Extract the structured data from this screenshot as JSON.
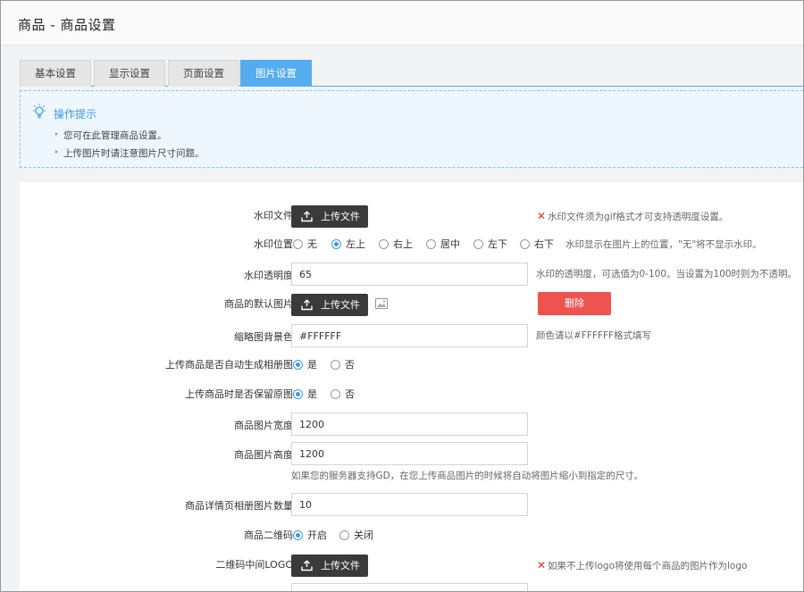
{
  "header": {
    "title": "商品 - 商品设置"
  },
  "tabs": [
    {
      "label": "基本设置",
      "active": false
    },
    {
      "label": "显示设置",
      "active": false
    },
    {
      "label": "页面设置",
      "active": false
    },
    {
      "label": "图片设置",
      "active": true
    }
  ],
  "tips": {
    "title": "操作提示",
    "items": [
      "您可在此管理商品设置。",
      "上传图片时请注意图片尺寸问题。"
    ]
  },
  "upload_label": "上传文件",
  "form": {
    "watermark_file": {
      "label": "水印文件：",
      "note": "水印文件须为gif格式才可支持透明度设置。"
    },
    "watermark_position": {
      "label": "水印位置：",
      "options": [
        "无",
        "左上",
        "右上",
        "居中",
        "左下",
        "右下"
      ],
      "selected": "左上",
      "note": "水印显示在图片上的位置，\"无\"将不显示水印。"
    },
    "watermark_opacity": {
      "label": "水印透明度：",
      "value": "65",
      "note": "水印的透明度，可选值为0-100。当设置为100时则为不透明。"
    },
    "default_image": {
      "label": "商品的默认图片：",
      "delete_label": "删除"
    },
    "thumb_bg": {
      "label": "缩略图背景色：",
      "value": "#FFFFFF",
      "note": "颜色请以#FFFFFF格式填写"
    },
    "auto_album": {
      "label": "上传商品是否自动生成相册图：",
      "options": [
        "是",
        "否"
      ],
      "selected": "是"
    },
    "keep_original": {
      "label": "上传商品时是否保留原图：",
      "options": [
        "是",
        "否"
      ],
      "selected": "是"
    },
    "image_width": {
      "label": "商品图片宽度：",
      "value": "1200"
    },
    "image_height": {
      "label": "商品图片高度：",
      "value": "1200",
      "note": "如果您的服务器支持GD，在您上传商品图片的时候将自动将图片缩小到指定的尺寸。"
    },
    "album_count": {
      "label": "商品详情页相册图片数量：",
      "value": "10"
    },
    "qrcode": {
      "label": "商品二维码：",
      "options": [
        "开启",
        "关闭"
      ],
      "selected": "开启"
    },
    "qrcode_logo": {
      "label": "二维码中间LOGO：",
      "note": "如果不上传logo将使用每个商品的图片作为logo"
    }
  },
  "colors": {
    "accent": "#55acee",
    "tip_title": "#3c9ae3",
    "delete": "#ef5350",
    "error_x": "#e0302a",
    "upload_btn": "#3a3a3a"
  }
}
